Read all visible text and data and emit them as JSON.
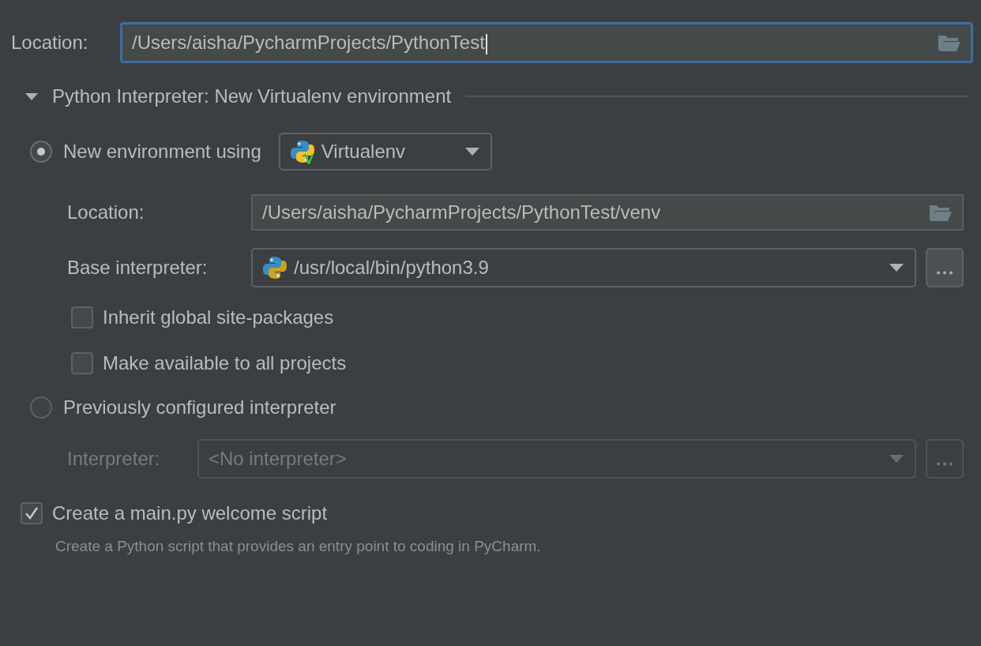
{
  "location": {
    "label": "Location:",
    "value": "/Users/aisha/PycharmProjects/PythonTest",
    "focused": true
  },
  "interpreter_section": {
    "title": "Python Interpreter: New Virtualenv environment",
    "expanded": true,
    "options": [
      {
        "label": "New environment using",
        "selected": true,
        "tool": "Virtualenv",
        "fields": [
          {
            "label": "Location:",
            "value": "/Users/aisha/PycharmProjects/PythonTest/venv",
            "kind": "path",
            "disabled": false
          },
          {
            "label": "Base interpreter:",
            "value": "/usr/local/bin/python3.9",
            "kind": "dropdown",
            "disabled": false
          }
        ],
        "checkboxes": [
          {
            "label": "Inherit global site-packages",
            "checked": false
          },
          {
            "label": "Make available to all projects",
            "checked": false
          }
        ]
      },
      {
        "label": "Previously configured interpreter",
        "selected": false,
        "fields": [
          {
            "label": "Interpreter:",
            "value": "<No interpreter>",
            "kind": "dropdown",
            "disabled": true
          }
        ]
      }
    ]
  },
  "welcome_script": {
    "label": "Create a main.py welcome script",
    "checked": true,
    "description": "Create a Python script that provides an entry point to coding in PyCharm."
  }
}
